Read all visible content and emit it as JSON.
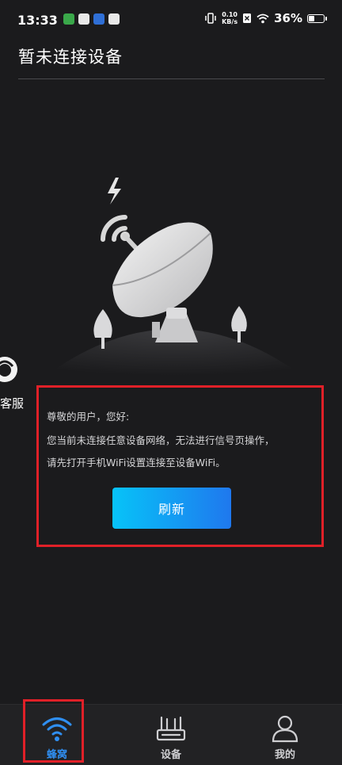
{
  "status_bar": {
    "time": "13:33",
    "net_speed_value": "0.10",
    "net_speed_unit": "KB/s",
    "battery_percent": "36%",
    "battery_level": 0.36
  },
  "header": {
    "title": "暂未连接设备"
  },
  "support": {
    "label": "客服"
  },
  "notice": {
    "greeting": "尊敬的用户，您好:",
    "line1": "您当前未连接任意设备网络，无法进行信号页操作，",
    "line2": "请先打开手机WiFi设置连接至设备WiFi。",
    "refresh_label": "刷新"
  },
  "tabs": [
    {
      "label": "蜂窝",
      "icon": "wifi-icon",
      "active": true
    },
    {
      "label": "设备",
      "icon": "router-icon",
      "active": false
    },
    {
      "label": "我的",
      "icon": "person-icon",
      "active": false
    }
  ],
  "colors": {
    "background": "#1b1b1d",
    "accent": "#2f8ff2",
    "highlight_border": "#e02028",
    "button_gradient_start": "#07c3f8",
    "button_gradient_end": "#1f78ee"
  }
}
